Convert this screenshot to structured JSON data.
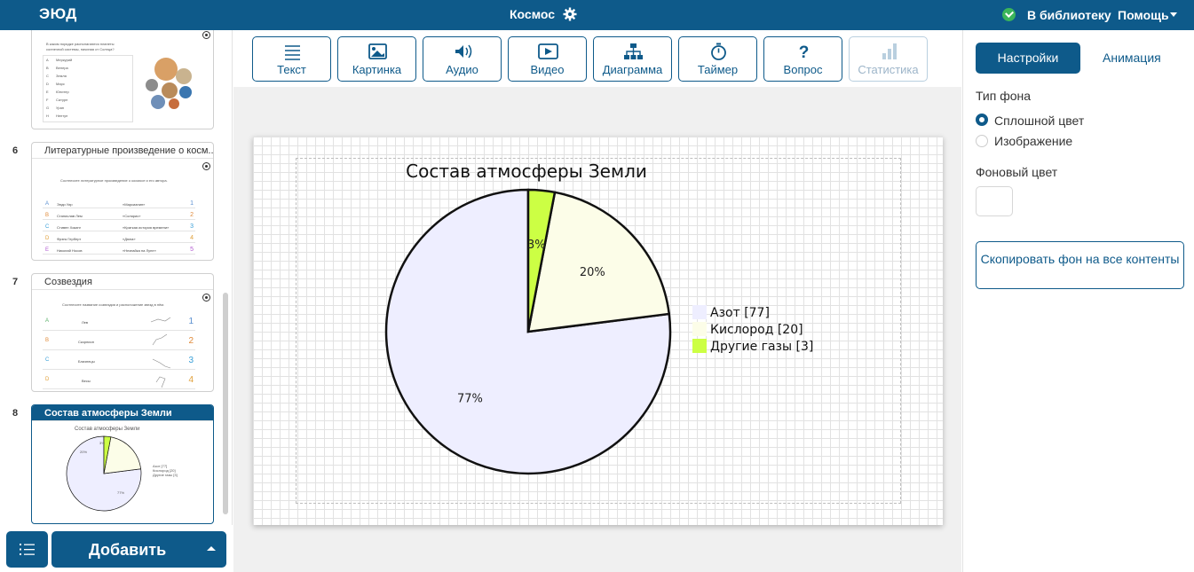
{
  "topbar": {
    "logo": "ЭЮД",
    "title": "Космос",
    "library_label": "В библиотеку",
    "help_label": "Помощь"
  },
  "sidebar": {
    "slide5": {
      "question": [
        "В каком порядке располагаются планеты",
        "солнечной системы, начиная от Солнца?"
      ],
      "rows": [
        {
          "letter": "A",
          "text": "Меркурий"
        },
        {
          "letter": "B",
          "text": "Венера"
        },
        {
          "letter": "C",
          "text": "Земля"
        },
        {
          "letter": "D",
          "text": "Марс"
        },
        {
          "letter": "E",
          "text": "Юпитер"
        },
        {
          "letter": "F",
          "text": "Сатурн"
        },
        {
          "letter": "G",
          "text": "Уран"
        },
        {
          "letter": "H",
          "text": "Нептун"
        }
      ]
    },
    "slides": [
      {
        "number": "6",
        "title": "Литературные произведение о косм...",
        "subtitle": "Соотнесите литературное произведение о космосе и его автора.",
        "rows": [
          {
            "letter": "A",
            "a": "Энди Уир",
            "b": "«Марсианин»",
            "n": "1"
          },
          {
            "letter": "B",
            "a": "Станислав Лем",
            "b": "«Солярис»",
            "n": "2"
          },
          {
            "letter": "C",
            "a": "Стивен Хокинг",
            "b": "«Краткая история времени»",
            "n": "3"
          },
          {
            "letter": "D",
            "a": "Фрэнк Герберт",
            "b": "«Дюна»",
            "n": "4"
          },
          {
            "letter": "E",
            "a": "Николай Носов",
            "b": "«Незнайка на Луне»",
            "n": "5"
          }
        ]
      },
      {
        "number": "7",
        "title": "Созвездия",
        "subtitle": "Соотнесите название созвездия и расположение звезд в нём.",
        "rows": [
          {
            "letter": "A",
            "a": "Лев",
            "n": "1"
          },
          {
            "letter": "B",
            "a": "Скорпион",
            "n": "2"
          },
          {
            "letter": "C",
            "a": "Близнецы",
            "n": "3"
          },
          {
            "letter": "D",
            "a": "Весы",
            "n": "4"
          }
        ]
      },
      {
        "number": "8",
        "title": "Состав атмосферы Земли"
      }
    ],
    "thumb_chart": {
      "title": "Состав атмосферы Земли",
      "legend": [
        "Азот [77]",
        "Кислород [20]",
        "Другие газы [3]"
      ],
      "labels": [
        "77%",
        "20%",
        "3%"
      ]
    },
    "add_label": "Добавить"
  },
  "toolbar": [
    {
      "label": "Текст",
      "icon": "text-lines-icon",
      "enabled": true
    },
    {
      "label": "Картинка",
      "icon": "image-icon",
      "enabled": true
    },
    {
      "label": "Аудио",
      "icon": "speaker-icon",
      "enabled": true
    },
    {
      "label": "Видео",
      "icon": "video-play-icon",
      "enabled": true
    },
    {
      "label": "Диаграмма",
      "icon": "diagram-tree-icon",
      "enabled": true
    },
    {
      "label": "Таймер",
      "icon": "timer-icon",
      "enabled": true
    },
    {
      "label": "Вопрос",
      "icon": "question-icon",
      "enabled": true
    },
    {
      "label": "Статистика",
      "icon": "bar-chart-icon",
      "enabled": false
    }
  ],
  "chart_data": {
    "type": "pie",
    "title": "Состав атмосферы Земли",
    "categories": [
      "Азот",
      "Кислород",
      "Другие газы"
    ],
    "values": [
      77,
      20,
      3
    ],
    "colors": [
      "#eeeeff",
      "#fcfde8",
      "#ccff44"
    ],
    "labels": [
      "77%",
      "20%",
      "3%"
    ],
    "legend": [
      "Азот [77]",
      "Кислород [20]",
      "Другие газы [3]"
    ],
    "legend_position": "right"
  },
  "right_panel": {
    "tab_settings": "Настройки",
    "tab_animation": "Анимация",
    "bg_type_label": "Тип фона",
    "option_solid": "Сплошной цвет",
    "option_image": "Изображение",
    "selected_option": "Сплошной цвет",
    "bg_color_label": "Фоновый цвет",
    "bg_color": "#ffffff",
    "copy_button": "Скопировать фон на все контенты"
  },
  "colors": {
    "primary": "#0e5a8a",
    "success": "#3bb55a"
  }
}
